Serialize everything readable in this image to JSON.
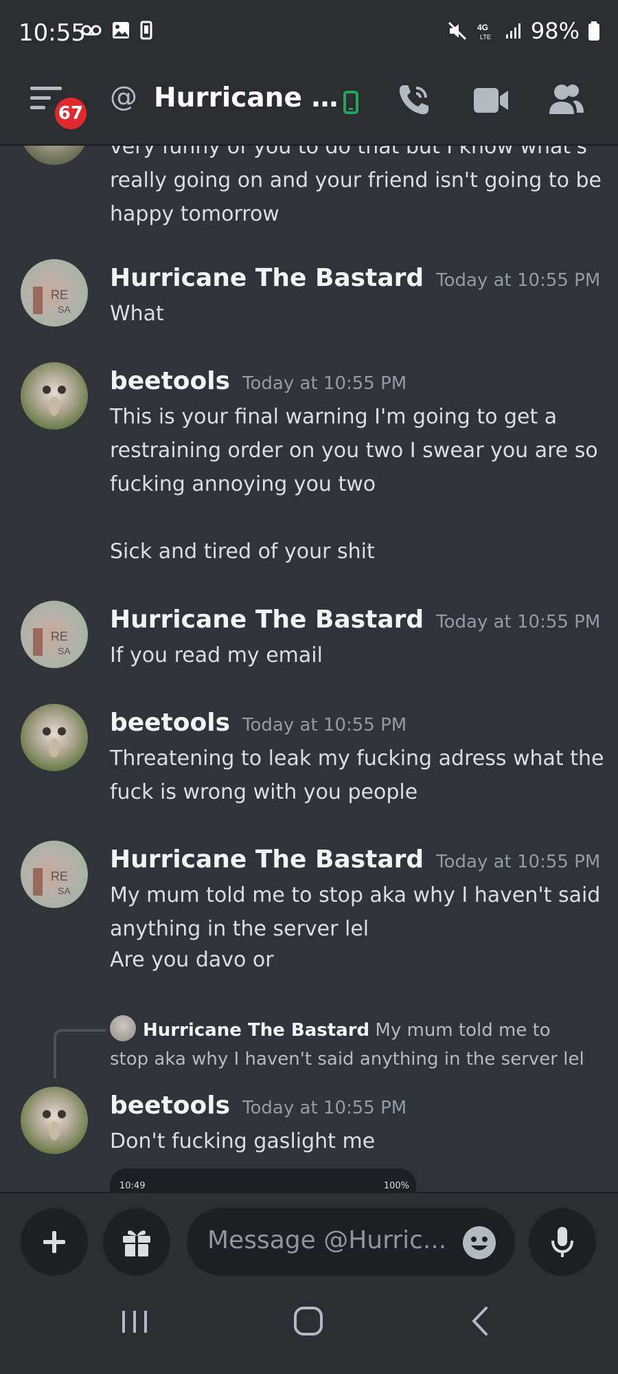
{
  "status_bar": {
    "time": "10:55",
    "battery": "98%"
  },
  "header": {
    "badge_count": "67",
    "title": "Hurricane Th..."
  },
  "messages": [
    {
      "kind": "continuation",
      "lines": [
        "very funny of you to do that but I know what's really going on and your friend isn't going to be happy tomorrow"
      ]
    },
    {
      "author": "Hurricane The Bastard",
      "timestamp": "Today at 10:55 PM",
      "lines": [
        "What"
      ]
    },
    {
      "author": "beetools",
      "timestamp": "Today at 10:55 PM",
      "lines": [
        "This is your final warning I'm going to get a restraining order on you two I swear you are so fucking annoying you two",
        "Sick and tired of your shit"
      ]
    },
    {
      "author": "Hurricane The Bastard",
      "timestamp": "Today at 10:55 PM",
      "lines": [
        "If you read my email"
      ]
    },
    {
      "author": "beetools",
      "timestamp": "Today at 10:55 PM",
      "lines": [
        "Threatening to leak my fucking adress what the fuck is wrong with you people"
      ]
    },
    {
      "author": "Hurricane The Bastard",
      "timestamp": "Today at 10:55 PM",
      "lines": [
        "My mum told me to stop aka why I haven't said anything in the server lel",
        "Are you davo or"
      ]
    },
    {
      "reply_to": {
        "author": "Hurricane The Bastard",
        "text": "My mum told me to stop aka why I haven't said anything in the server lel"
      },
      "author": "beetools",
      "timestamp": "Today at 10:55 PM",
      "lines": [
        "Don't fucking gaslight me"
      ],
      "attachment_preview": {
        "time": "10:49",
        "battery": "100%"
      }
    }
  ],
  "composer": {
    "placeholder": "Message @Hurric..."
  },
  "colors": {
    "background": "#313338",
    "header_bg": "#2b2d31",
    "badge_red": "#e0282e",
    "online_green": "#23a55a",
    "text_primary": "#dbdee1",
    "text_muted": "#949ba4"
  },
  "icons": [
    "menu-icon",
    "at-icon",
    "mobile-status-icon",
    "voice-call-icon",
    "video-call-icon",
    "members-icon",
    "plus-icon",
    "gift-icon",
    "emoji-icon",
    "microphone-icon",
    "recent-apps-icon",
    "home-icon",
    "back-icon"
  ]
}
